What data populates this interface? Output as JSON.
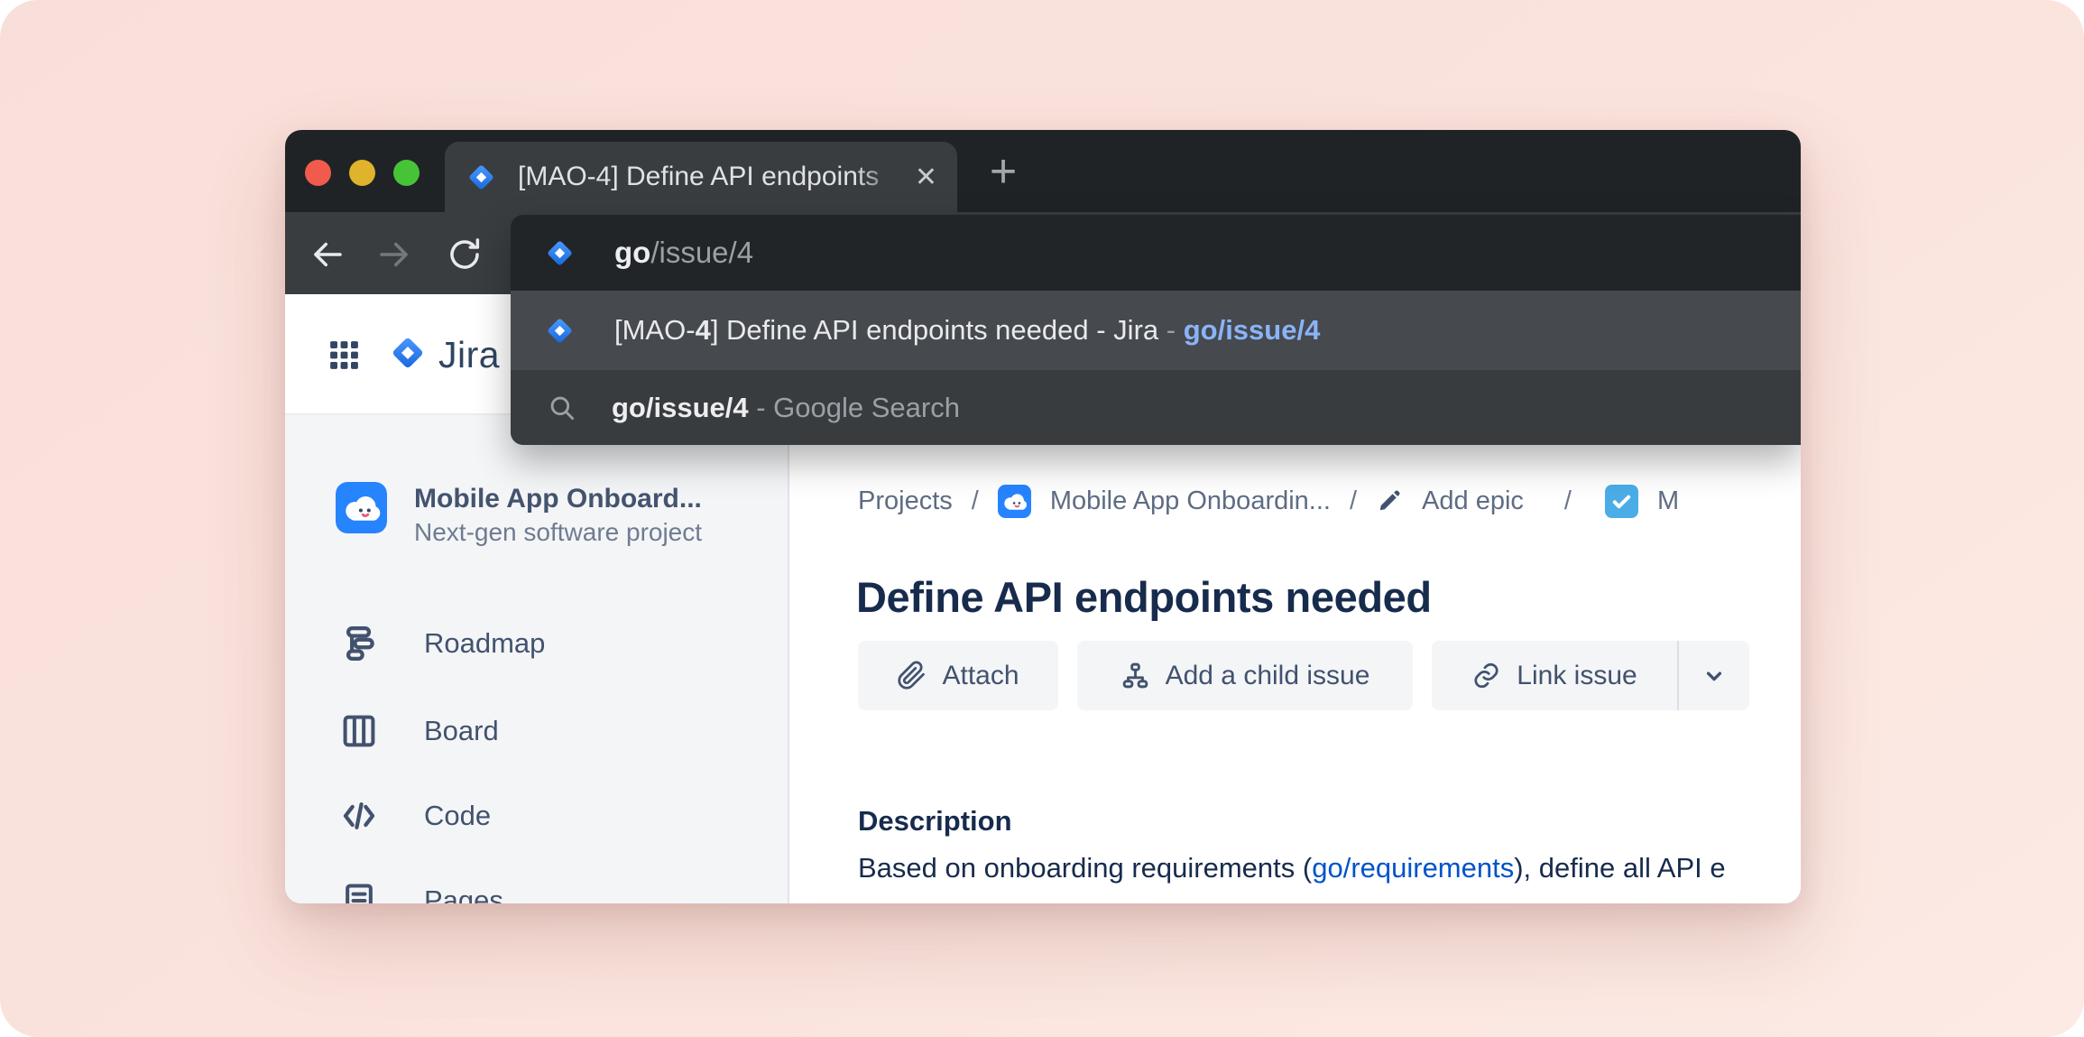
{
  "colors": {
    "jira_blue": "#2684FF",
    "suggestion_link_blue": "#8AB4F8",
    "description_link_blue": "#0052CC",
    "task_icon_blue": "#4BADE8",
    "heading_navy": "#172B4D",
    "ui_text_slate": "#42526E",
    "muted_slate": "#5E6C84",
    "pink_background": "#F9E1DB"
  },
  "browser": {
    "tab": {
      "title": "[MAO-4] Define API endpoints",
      "close_glyph": "✕",
      "new_tab_glyph": "+"
    },
    "omnibox": {
      "typed": "go",
      "autocomplete": "/issue/4"
    },
    "suggestions": {
      "primary": {
        "prefix": "[MAO-",
        "match": "4",
        "rest": "] Define API endpoints needed - Jira",
        "dash": " - ",
        "shortlink": "go/issue/4"
      },
      "search": {
        "query": "go/issue/4",
        "dash": " - ",
        "label": "Google Search"
      }
    }
  },
  "jira": {
    "brand": "Jira",
    "project": {
      "name": "Mobile App Onboard...",
      "subtitle": "Next-gen software project"
    },
    "sidebar": {
      "items": [
        {
          "label": "Roadmap"
        },
        {
          "label": "Board"
        },
        {
          "label": "Code"
        },
        {
          "label": "Pages"
        }
      ]
    },
    "breadcrumb": {
      "root": "Projects",
      "sep": "/",
      "project": "Mobile App Onboardin...",
      "add_epic": "Add epic",
      "issue_prefix": "M"
    },
    "issue": {
      "title": "Define API endpoints needed"
    },
    "actions": {
      "attach": "Attach",
      "add_child": "Add a child issue",
      "link": "Link issue"
    },
    "description": {
      "heading": "Description",
      "text_before_link": "Based on onboarding requirements (",
      "link": "go/requirements",
      "text_after_link": "), define all API e"
    }
  }
}
